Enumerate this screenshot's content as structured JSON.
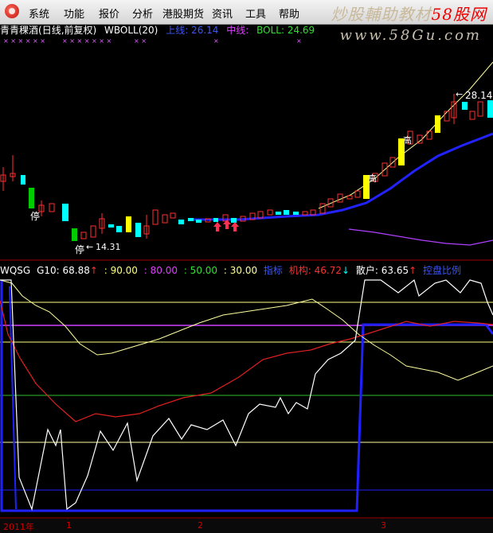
{
  "menu": {
    "items": [
      "系统",
      "功能",
      "报价",
      "分析",
      "港股期货",
      "资讯",
      "工具",
      "帮助"
    ]
  },
  "watermark": {
    "brand_text": "炒股輔助教材",
    "brand_num": "58股网",
    "url": "www.58Gu.com"
  },
  "main_panel": {
    "stock_name": "青青稞酒",
    "period": "(日线,前复权)",
    "indicator": "WBOLL(20)",
    "up_label": "上线: 26.14",
    "mid_label": "中线:",
    "boll_label": "BOLL: 24.69",
    "high_label": "28.14",
    "low_label": "14.31",
    "tags": [
      "停",
      "停",
      "高"
    ]
  },
  "indicator_panel": {
    "name": "WQSG",
    "g10": "G10: 68.88",
    "l90": ": 90.00",
    "l80": ": 80.00",
    "l50": ": 50.00",
    "l30": ": 30.00",
    "label_a": "指标",
    "jigou": "机构: 46.72",
    "sanhu": "散户: 63.65",
    "label_b": "控盘比例"
  },
  "date_axis": {
    "year": "2011年",
    "months": [
      "1",
      "2",
      "3"
    ]
  },
  "colors": {
    "rise": "#ff3030",
    "fall": "#00ffff",
    "yellow_candle": "#ffff00",
    "green_candle": "#00cc00",
    "boll_mid": "#2222ff",
    "lines": "#ffff90"
  }
}
